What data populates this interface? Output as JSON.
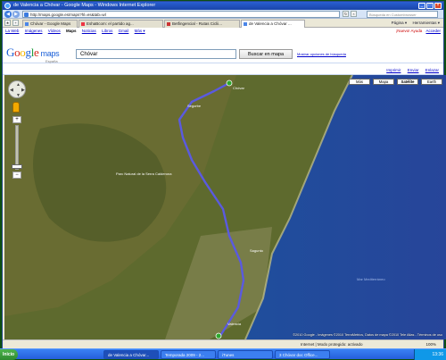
{
  "window": {
    "title": "de Valencia a Chóvar - Google Maps - Windows Internet Explorer",
    "controls": [
      "_",
      "□",
      "×"
    ]
  },
  "addressbar": {
    "url": "http://maps.google.es/maps?hl=es&tab=wl",
    "search_placeholder": "Búsqueda en Custombrowser"
  },
  "tabs": [
    {
      "label": "Chóvar - Google Maps"
    },
    {
      "label": "EshaBcom: el partido ag..."
    },
    {
      "label": "Betfingencial - Rutas Ciclii..."
    },
    {
      "label": "de Valencia a Chóvar ..."
    }
  ],
  "commandbar": {
    "page": "Página ▾",
    "tools": "Herramientas ▾"
  },
  "google_nav": {
    "items": [
      "La Web",
      "Imágenes",
      "Vídeos",
      "Maps",
      "Noticias",
      "Libros",
      "Gmail",
      "Más ▾"
    ],
    "selected": "Maps",
    "user": "¡Nuevo! Ayuda",
    "help": "Ayuda",
    "login": "Acceder"
  },
  "header": {
    "logo_google": "Google",
    "logo_maps": "maps",
    "logo_region": "España",
    "search_value": "Chóvar",
    "search_button": "Buscar en mapa",
    "search_options": "Mostrar opciones de búsqueda"
  },
  "map_links": {
    "print": "Imprimir",
    "send": "Enviar",
    "link": "Enlazar"
  },
  "map_types": [
    "Más",
    "Mapa",
    "Satélite",
    "Earth"
  ],
  "map_type_selected": "Satélite",
  "map_controls": {
    "zoom_in": "+",
    "zoom_out": "−"
  },
  "map_labels": [
    {
      "text": "Segorbe"
    },
    {
      "text": "Chóvar"
    },
    {
      "text": "Sagunto"
    },
    {
      "text": "Valencia"
    },
    {
      "text": "Parc Natural de la Serra Calderona"
    },
    {
      "text": "Mar Mediterráneo"
    }
  ],
  "copyright": "©2010 Google - Imágenes ©2010 TerraMetrics, Datos de mapa ©2010 Tele Atlas - Términos de uso",
  "statusbar": {
    "zone": "Internet | Modo protegido: activado",
    "zoom": "100%"
  },
  "taskbar": {
    "start": "Inicio",
    "tasks": [
      {
        "label": "de Valencia a Chóvar..."
      },
      {
        "label": "Temporada 2009 - 2..."
      },
      {
        "label": "iTunes"
      },
      {
        "label": "3 Chóvar doc Office..."
      }
    ],
    "active_task": 0,
    "clock": "13:36"
  }
}
